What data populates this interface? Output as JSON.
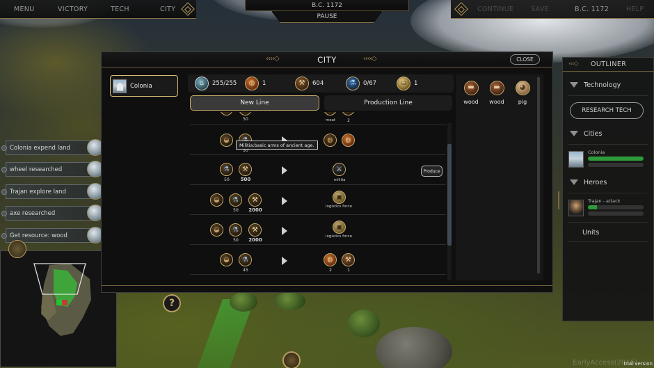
{
  "top_menu": {
    "left": [
      "MENU",
      "VICTORY",
      "TECH",
      "CITY"
    ],
    "date": "B.C. 1172",
    "pause": "PAUSE",
    "right": [
      "CONTINUE",
      "SAVE",
      "B.C. 1172",
      "HELP"
    ]
  },
  "events": [
    {
      "text": "Colonia expend land",
      "icon": "wheat-icon"
    },
    {
      "text": "wheel researched",
      "icon": "scroll-icon"
    },
    {
      "text": "Trajan explore land",
      "icon": "globe-icon"
    },
    {
      "text": "axe researched",
      "icon": "scroll-icon"
    },
    {
      "text": "Get resource: wood",
      "icon": "wheat-icon"
    }
  ],
  "city_window": {
    "title": "CITY",
    "close": "CLOSE",
    "city_tab": "Colonia",
    "resources": [
      {
        "icon": "population-icon",
        "value": "255/255"
      },
      {
        "icon": "food-icon",
        "value": "1"
      },
      {
        "icon": "hammer-icon",
        "value": "604"
      },
      {
        "icon": "flask-icon",
        "value": "0/67"
      },
      {
        "icon": "gold-icon",
        "value": "1"
      }
    ],
    "tabs": {
      "new_line": "New Line",
      "production_line": "Production Line"
    },
    "rows": [
      {
        "top_label_1": "meat",
        "top_label_2": "2",
        "top_num": "50"
      },
      {
        "inputs": [
          "bag-icon",
          "flask-icon"
        ],
        "input_nums": [
          "",
          "50"
        ],
        "outputs": [
          "meat-icon",
          "food-icon"
        ],
        "tooltip": "Militia:basic arms of ancient age."
      },
      {
        "inputs": [
          "flask-icon",
          "hammer-icon"
        ],
        "input_nums": [
          "50",
          "500"
        ],
        "outputs": [
          "axe-icon"
        ],
        "output_labels": [
          "militia"
        ],
        "button": "Produce"
      },
      {
        "inputs": [
          "bag-icon",
          "flask-icon",
          "hammer-icon"
        ],
        "input_nums": [
          "",
          "50",
          "2000"
        ],
        "outputs": [
          "crate-icon"
        ],
        "output_labels": [
          "logistics force"
        ]
      },
      {
        "inputs": [
          "bag-icon",
          "flask-icon",
          "hammer-icon"
        ],
        "input_nums": [
          "",
          "50",
          "2000"
        ],
        "outputs": [
          "crate-icon"
        ],
        "output_labels": [
          "logistics force"
        ]
      },
      {
        "inputs": [
          "bag-icon",
          "flask-icon"
        ],
        "input_nums": [
          "",
          "45"
        ],
        "outputs": [
          "food-icon",
          "axe-icon"
        ],
        "output_nums": [
          "2",
          "1"
        ]
      }
    ],
    "inventory": [
      {
        "icon": "wood-icon",
        "label": "wood"
      },
      {
        "icon": "wood-icon",
        "label": "wood"
      },
      {
        "icon": "pig-icon",
        "label": "pig"
      }
    ]
  },
  "outliner": {
    "title": "OUTLINER",
    "sections": {
      "technology": "Technology",
      "research_button": "RESEARCH TECH",
      "cities": "Cities",
      "heroes": "Heroes",
      "units": "Units"
    },
    "city_entry": {
      "name": "Colonia",
      "bar1": 1.0,
      "bar2": 0
    },
    "hero_entry": {
      "name": "Trajan - attack",
      "bar1": 0.16,
      "bar2": 0
    }
  },
  "footer": {
    "watermark": "EarlyAccess(2016)",
    "trial": "trial version"
  },
  "colors": {
    "gold_border": "#c7ab6d",
    "bar_green": "#2f9a3a",
    "panel": "#0f0f0f"
  }
}
